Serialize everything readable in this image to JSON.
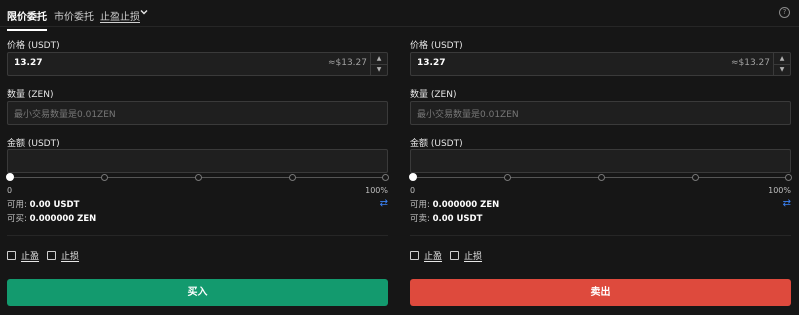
{
  "tabs": [
    {
      "label": "限价委托"
    },
    {
      "label": "市价委托"
    },
    {
      "label": "止盈止损"
    }
  ],
  "icons": {
    "dropdown": "chevron-down-icon",
    "help": "help-circle-icon",
    "swap": "swap-arrows-icon"
  },
  "help_glyph": "?",
  "buy": {
    "price_label": "价格 (USDT)",
    "price_value": "13.27",
    "price_approx": "≈$13.27",
    "qty_label": "数量 (ZEN)",
    "qty_placeholder": "最小交易数量是0.01ZEN",
    "amount_label": "金额 (USDT)",
    "amount_value": "",
    "slider_min": "0",
    "slider_max": "100%",
    "slider_level": 0,
    "available_label": "可用:",
    "available_value": "0.00 USDT",
    "can_label": "可买:",
    "can_value": "0.000000 ZEN",
    "take_profit": "止盈",
    "stop_loss": "止损",
    "action": "买入",
    "color": "#139a6e"
  },
  "sell": {
    "price_label": "价格 (USDT)",
    "price_value": "13.27",
    "price_approx": "≈$13.27",
    "qty_label": "数量 (ZEN)",
    "qty_placeholder": "最小交易数量是0.01ZEN",
    "amount_label": "金额 (USDT)",
    "amount_value": "",
    "slider_min": "0",
    "slider_max": "100%",
    "slider_level": 0,
    "available_label": "可用:",
    "available_value": "0.000000 ZEN",
    "can_label": "可卖:",
    "can_value": "0.00 USDT",
    "take_profit": "止盈",
    "stop_loss": "止损",
    "action": "卖出",
    "color": "#de4a3d"
  }
}
